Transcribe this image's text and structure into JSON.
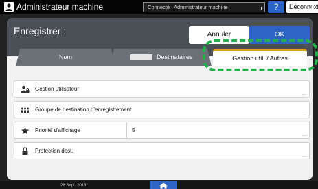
{
  "topbar": {
    "title": "Administrateur machine",
    "status": "Connecté : Administrateur machine",
    "help_label": "?",
    "logout_label": "Déconnexion"
  },
  "panel": {
    "title": "Enregistrer :",
    "cancel_label": "Annuler",
    "ok_label": "OK"
  },
  "tabs": [
    {
      "label": "Nom"
    },
    {
      "label": "Destinataires"
    },
    {
      "label": "Gestion util. / Autres",
      "active": true
    }
  ],
  "rows": [
    {
      "label": "Gestion utilisateur",
      "value": "",
      "icon": "user-management-icon"
    },
    {
      "label": "Groupe de destination d'enregistrement",
      "value": "",
      "icon": "group-icon"
    },
    {
      "label": "Priorité d'affichage",
      "value": "5",
      "icon": "star-icon"
    },
    {
      "label": "Protection dest.",
      "value": "",
      "icon": "lock-icon"
    }
  ],
  "bottombar": {
    "date": "28 Sept. 2018"
  },
  "colors": {
    "accent_blue": "#2d64c6",
    "active_tab_top": "#d9a520",
    "callout_green": "#22b14c"
  }
}
